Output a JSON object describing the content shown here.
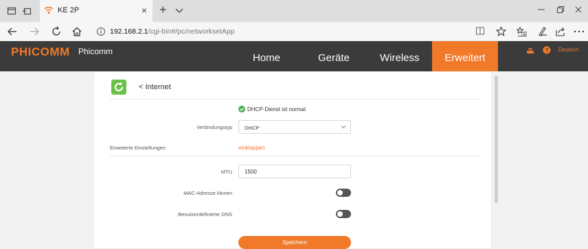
{
  "browser": {
    "tab_title": "KE 2P",
    "tab_close": "×",
    "new_tab": "+",
    "url_host": "192.168.2.1",
    "url_path": "/cgi-bin#/pc/networksetApp",
    "icons": [
      "tab-preview-icon",
      "tab-set-aside-icon",
      "wifi-icon",
      "back-arrow-icon",
      "forward-arrow-icon",
      "refresh-icon",
      "home-icon",
      "info-icon",
      "reading-view-icon",
      "favorite-star-icon",
      "favorites-bar-icon",
      "pen-icon",
      "share-icon",
      "more-icon"
    ]
  },
  "router": {
    "brand": "PHICOMM",
    "brand_sub": "Phicomm",
    "nav": {
      "home": "Home",
      "devices": "Geräte",
      "wireless": "Wireless",
      "advanced": "Erweitert"
    },
    "language": "Deutsch",
    "accent_color": "#f0792a",
    "header_color": "#3b3b3b"
  },
  "page": {
    "back_label": "< Internet",
    "status_text": "DHCP-Dienst ist normal",
    "connection_type_label": "Verbindungstyp",
    "connection_type_value": "DHCP",
    "advanced_settings_label": "Erweiterte Einstellungen",
    "collapse_label": "einklappen",
    "mtu_label": "MTU",
    "mtu_value": "1500",
    "mac_clone_label": "MAC-Adresse klonen",
    "mac_clone_on": false,
    "custom_dns_label": "Benutzerdefinierte DNS",
    "custom_dns_on": false,
    "save_label": "Speichern"
  }
}
